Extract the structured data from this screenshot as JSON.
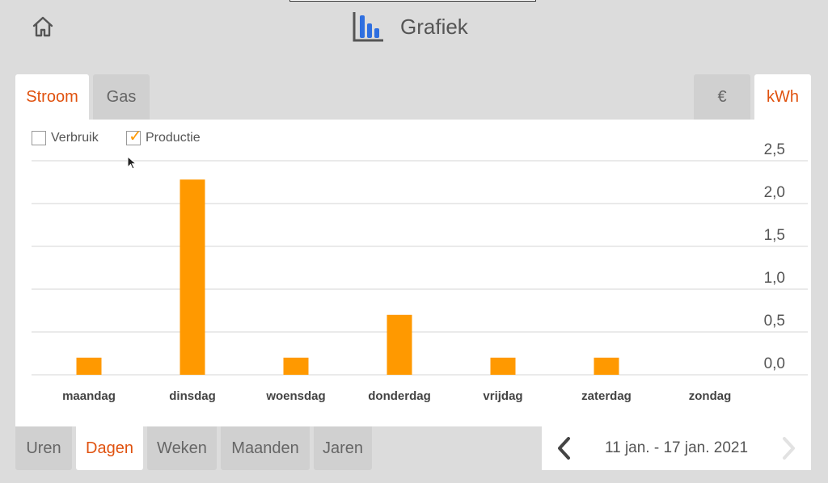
{
  "header": {
    "title": "Grafiek",
    "home_icon": "home-icon",
    "chart_icon": "bar-chart-icon"
  },
  "top_tabs": {
    "left": [
      "Stroom",
      "Gas"
    ],
    "active_left": "Stroom",
    "right": [
      "€",
      "kWh"
    ],
    "active_right": "kWh"
  },
  "filters": {
    "verbruik": {
      "label": "Verbruik",
      "checked": false
    },
    "productie": {
      "label": "Productie",
      "checked": true
    }
  },
  "bottom_tabs": {
    "items": [
      "Uren",
      "Dagen",
      "Weken",
      "Maanden",
      "Jaren"
    ],
    "active": "Dagen"
  },
  "date_range": "11 jan. - 17 jan. 2021",
  "colors": {
    "accent": "#e0520f",
    "bar": "#ff9900",
    "icon_blue": "#2f6fe0"
  },
  "chart_data": {
    "type": "bar",
    "categories": [
      "maandag",
      "dinsdag",
      "woensdag",
      "donderdag",
      "vrijdag",
      "zaterdag",
      "zondag"
    ],
    "values": [
      0.2,
      2.28,
      0.2,
      0.7,
      0.2,
      0.2,
      0
    ],
    "yticks": [
      "2,5",
      "2,0",
      "1,5",
      "1,0",
      "0,5",
      "0,0"
    ],
    "ylim": [
      0,
      2.5
    ],
    "grid": true
  }
}
